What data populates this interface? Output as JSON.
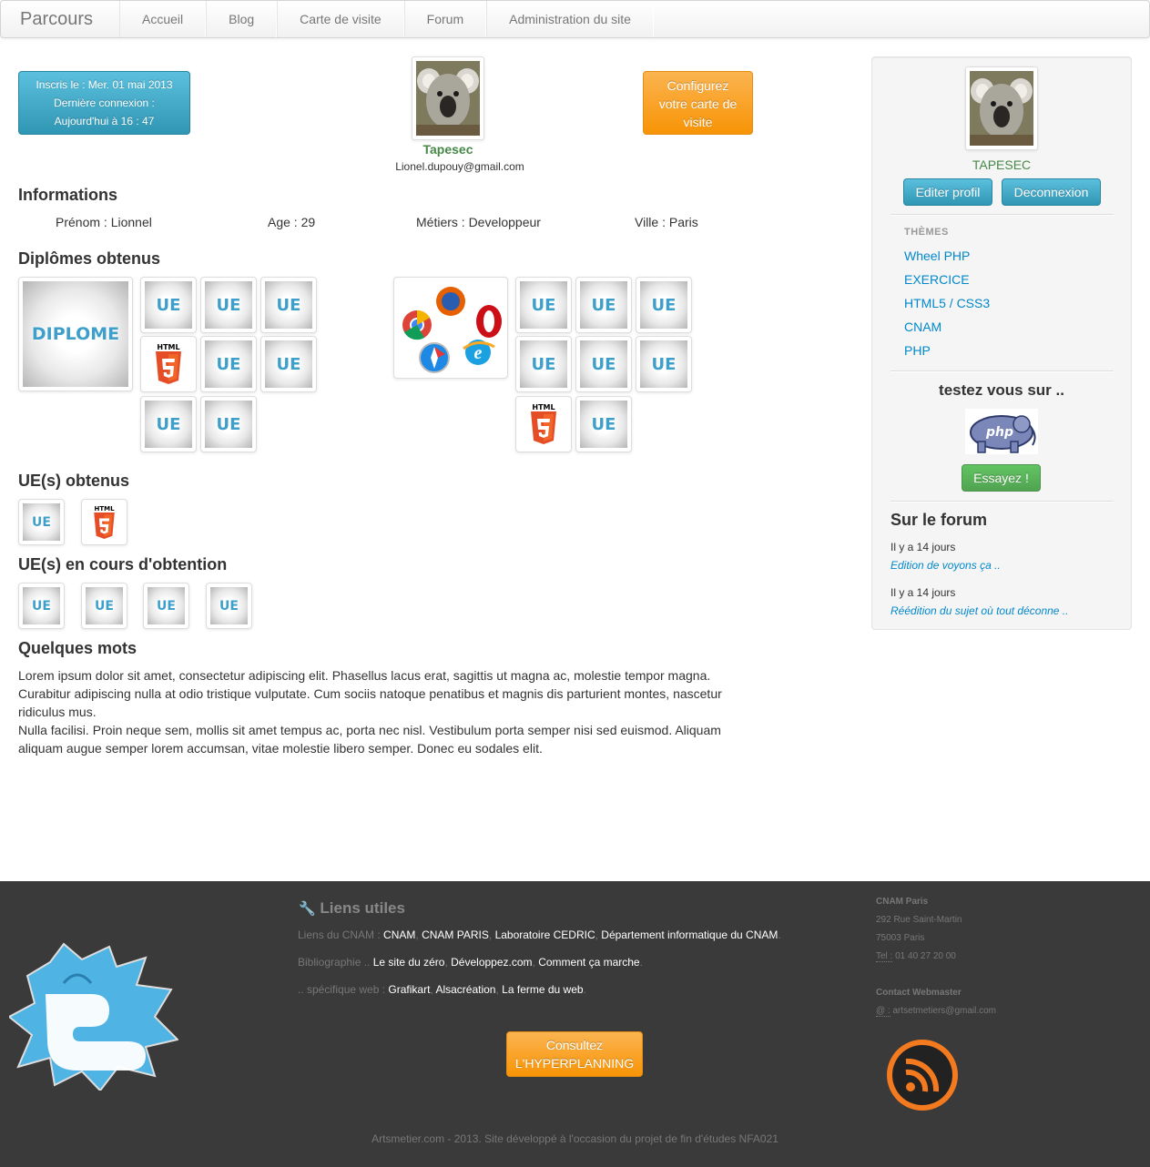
{
  "navbar": {
    "brand": "Parcours",
    "items": [
      "Accueil",
      "Blog",
      "Carte de visite",
      "Forum",
      "Administration du site"
    ]
  },
  "profile": {
    "signup_line1": "Inscris le : Mer. 01 mai 2013",
    "signup_line2": "Dernière connexion :",
    "signup_line3": "Aujourd'hui à 16 : 47",
    "username": "Tapesec",
    "email": "Lionel.dupouy@gmail.com",
    "configure_line1": "Configurez",
    "configure_line2": "votre carte de",
    "configure_line3": "visite"
  },
  "informations": {
    "title": "Informations",
    "prenom": "Prénom : Lionnel",
    "age": "Age : 29",
    "metiers": "Métiers : Developpeur",
    "ville": "Ville : Paris"
  },
  "diplomes": {
    "title": "Diplômes obtenus",
    "diploma_label": "DIPLOME",
    "ue_label": "UE",
    "html5_label": "HTML"
  },
  "ue_obtenus": {
    "title": "UE(s) obtenus"
  },
  "ue_en_cours": {
    "title": "UE(s) en cours d'obtention"
  },
  "quelques_mots": {
    "title": "Quelques mots",
    "para1_line1": "Lorem ipsum dolor sit amet, consectetur adipiscing elit. Phasellus lacus erat, sagittis ut magna ac, molestie tempor magna.",
    "para1_line2": "Curabitur adipiscing nulla at odio tristique vulputate. Cum sociis natoque penatibus et magnis dis parturient montes, nascetur",
    "para1_line3": "ridiculus mus.",
    "para2_line1": "Nulla facilisi. Proin neque sem, mollis sit amet tempus ac, porta nec nisl. Vestibulum porta semper nisi sed euismod. Aliquam",
    "para2_line2": "aliquam augue semper lorem accumsan, vitae molestie libero semper. Donec eu sodales elit."
  },
  "sidebar": {
    "username": "TAPESEC",
    "edit_profile": "Editer profil",
    "logout": "Deconnexion",
    "themes_header": "THÈMES",
    "themes": [
      "Wheel PHP",
      "EXERCICE",
      "HTML5 / CSS3",
      "CNAM",
      "PHP"
    ],
    "test_title": "testez vous sur ..",
    "php_logo_text": "php",
    "try_button": "Essayez !",
    "forum_title": "Sur le forum",
    "forum_posts": [
      {
        "time": "Il y a 14 jours",
        "title": "Edition de voyons ça .."
      },
      {
        "time": "Il y a 14 jours",
        "title": "Réédition du sujet où tout déconne .."
      }
    ]
  },
  "footer": {
    "links_title": "Liens utiles",
    "cnam_prefix": "Liens du CNAM :",
    "cnam_links": [
      "CNAM",
      "CNAM PARIS",
      "Laboratoire CEDRIC",
      "Département informatique du CNAM"
    ],
    "biblio_prefix": "Bibliographie ..",
    "biblio_links": [
      "Le site du zéro",
      "Développez.com",
      "Comment ça marche"
    ],
    "web_prefix": ".. spécifique web :",
    "web_links": [
      "Grafikart",
      "Alsacréation",
      "La ferme du web"
    ],
    "hyper_line1": "Consultez",
    "hyper_line2": "L'HYPERPLANNING",
    "address_title": "CNAM Paris",
    "address_street": "292 Rue Saint-Martin",
    "address_city": "75003 Paris",
    "tel_label": "Tel :",
    "tel_value": "01 40 27 20 00",
    "contact_title": "Contact Webmaster",
    "contact_label": "@ :",
    "contact_email": "artsetmetiers@gmail.com",
    "copyright": "Artsmetier.com - 2013. Site développé à l'occasion du projet de fin d'études NFA021"
  },
  "colors": {
    "link": "#0088cc",
    "username_green": "#468847",
    "footer_bg": "#3a3a3a",
    "ue_blue": "#3d9fca",
    "html5_orange": "#e44d26"
  }
}
